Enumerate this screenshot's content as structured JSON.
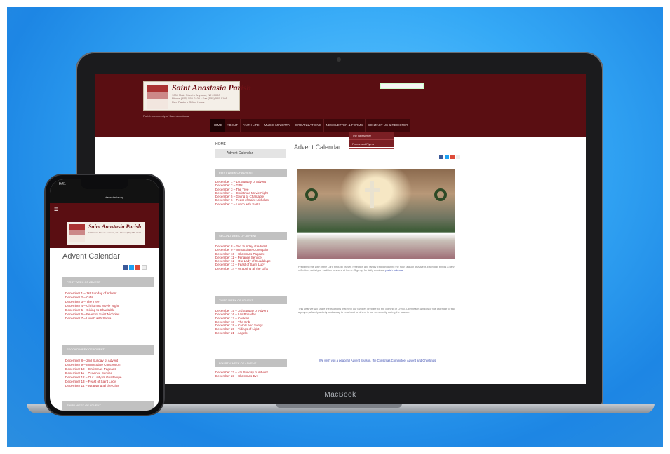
{
  "laptop": {
    "brand": "MacBook",
    "site": {
      "name": "Saint Anastasia Parish",
      "address_lines": [
        "1000 Main Street • Anytown, NJ 07000",
        "Phone (555) 555-0100 • Fax (555) 555-0101",
        "Rev. Pastor • Office Hours"
      ],
      "tagline": "Parish community of Saint Anastasia",
      "nav": [
        "HOME",
        "ABOUT",
        "FAITH LIFE",
        "MUSIC MINISTRY",
        "ORGANIZATIONS",
        "NEWSLETTER & FORMS",
        "CONTACT US & REGISTER"
      ],
      "dropdown": [
        "The Newsletter",
        "Forms and Flyers"
      ],
      "breadcrumb": "HOME",
      "sidebar_button": "Advent Calendar",
      "sections": [
        {
          "title": "FIRST WEEK OF ADVENT",
          "links": [
            "December 1 – 1st Sunday of Advent",
            "December 2 – Gifts",
            "December 3 – The Tree",
            "December 4 – Christmas Movie Night",
            "December 5 – Giving to Charitable",
            "December 6 – Feast of Saint Nicholas",
            "December 7 – Lunch with Santa"
          ]
        },
        {
          "title": "SECOND WEEK OF ADVENT",
          "links": [
            "December 8 – 2nd Sunday of Advent",
            "December 9 – Immaculate Conception",
            "December 10 – Christmas Pageant",
            "December 11 – Penance Service",
            "December 12 – Our Lady of Guadalupe",
            "December 13 – Feast of Saint Lucy",
            "December 14 – Wrapping all the Gifts"
          ]
        },
        {
          "title": "THIRD WEEK OF ADVENT",
          "links": [
            "December 15 – 3rd Sunday of Advent",
            "December 16 – Las Posadas",
            "December 17 – Cookies",
            "December 18 – The Crib",
            "December 19 – Carols and Songs",
            "December 20 – Tidings of Light",
            "December 21 – Angels"
          ]
        },
        {
          "title": "FOURTH WEEK OF ADVENT",
          "links": [
            "December 22 – 4th Sunday of Advent",
            "December 23 – Christmas Eve"
          ]
        }
      ],
      "main_title": "Advent Calendar",
      "paragraph1": "Preparing the way of the Lord through prayer, reflection and family tradition during the holy season of Advent. Each day brings a new reflection, activity or tradition to share at home. Sign up for daily emails at",
      "paragraph1_link": "parish calendar",
      "paragraph2": "This year we will share the traditions that help our families prepare for the coming of Christ. Open each window of the calendar to find a prayer, a family activity and a way to reach out to others in our community during the season.",
      "closing": "We wish you a peaceful Advent Season, the Christmas Committee, Advent and Christmas"
    }
  },
  "phone": {
    "time": "9:41",
    "url": "stanastasia.org",
    "menu_icon": "hamburger-icon",
    "site_name": "Saint Anastasia Parish",
    "address": "1000 Main Street • Anytown, NJ • Phone (555) 555-0100",
    "title": "Advent Calendar",
    "sections": [
      {
        "title": "FIRST WEEK OF ADVENT",
        "links": [
          "December 1 – 1st Sunday of Advent",
          "December 2 – Gifts",
          "December 3 – The Tree",
          "December 4 – Christmas Movie Night",
          "December 5 – Giving to Charitable",
          "December 6 – Feast of Saint Nicholas",
          "December 7 – Lunch with Santa"
        ]
      },
      {
        "title": "SECOND WEEK OF ADVENT",
        "links": [
          "December 8 – 2nd Sunday of Advent",
          "December 9 – Immaculate Conception",
          "December 10 – Christmas Pageant",
          "December 11 – Penance Service",
          "December 12 – Our Lady of Guadalupe",
          "December 13 – Feast of Saint Lucy",
          "December 14 – Wrapping all the Gifts"
        ]
      },
      {
        "title": "THIRD WEEK OF ADVENT",
        "links": []
      }
    ]
  },
  "colors": {
    "maroon": "#5a0e12",
    "link_red": "#c0272d",
    "link_blue": "#3a4cb0",
    "background_blue": "#35a9f6"
  }
}
